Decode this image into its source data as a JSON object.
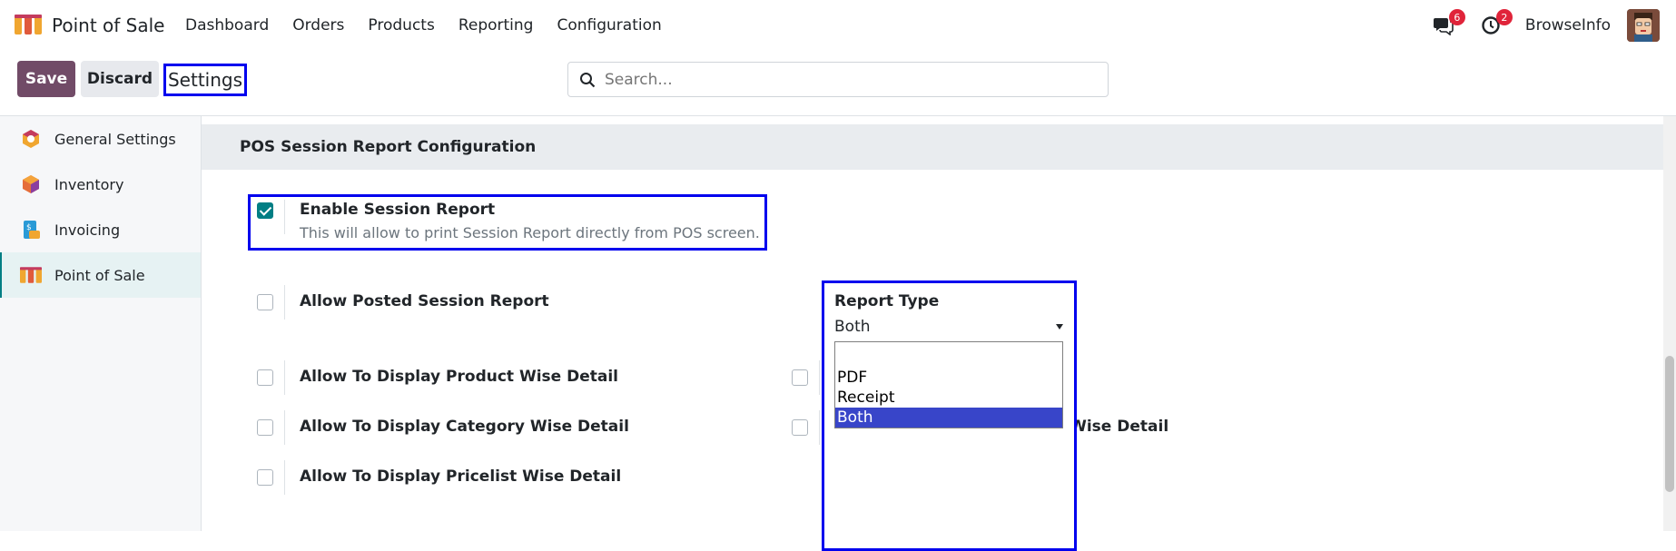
{
  "navbar": {
    "app_name": "Point of Sale",
    "menu": [
      "Dashboard",
      "Orders",
      "Products",
      "Reporting",
      "Configuration"
    ],
    "messages_count": "6",
    "activities_count": "2",
    "company": "BrowseInfo"
  },
  "control_panel": {
    "save_label": "Save",
    "discard_label": "Discard",
    "title": "Settings",
    "search_placeholder": "Search..."
  },
  "sidebar": {
    "items": [
      {
        "label": "General Settings",
        "icon": "settings-hexagon-icon"
      },
      {
        "label": "Inventory",
        "icon": "inventory-box-icon"
      },
      {
        "label": "Invoicing",
        "icon": "invoice-icon"
      },
      {
        "label": "Point of Sale",
        "icon": "pos-store-icon",
        "active": true
      }
    ]
  },
  "main": {
    "section_title": "POS Session Report Configuration",
    "enable_session_report": {
      "label": "Enable Session Report",
      "description": "This will allow to print Session Report directly from POS screen.",
      "checked": true
    },
    "allow_posted": {
      "label": "Allow Posted Session Report",
      "checked": false
    },
    "report_type": {
      "label": "Report Type",
      "value": "Both",
      "options": [
        "",
        "PDF",
        "Receipt",
        "Both"
      ]
    },
    "product_wise": {
      "label": "Allow To Display Product Wise Detail",
      "checked": false
    },
    "category_wise": {
      "label": "Allow To Display Category Wise Detail",
      "checked": false
    },
    "pricelist_wise": {
      "label": "Allow To Display Pricelist Wise Detail",
      "checked": false
    },
    "right_col_row1_partial": "i",
    "customer_wise": {
      "label": "Allow To Display Customer Wise Detail",
      "checked": false
    }
  },
  "colors": {
    "brand": "#714b67",
    "accent": "#017e84",
    "highlight_box": "#0000ee",
    "dropdown_selected": "#3845c9",
    "badge": "#e0243a"
  }
}
